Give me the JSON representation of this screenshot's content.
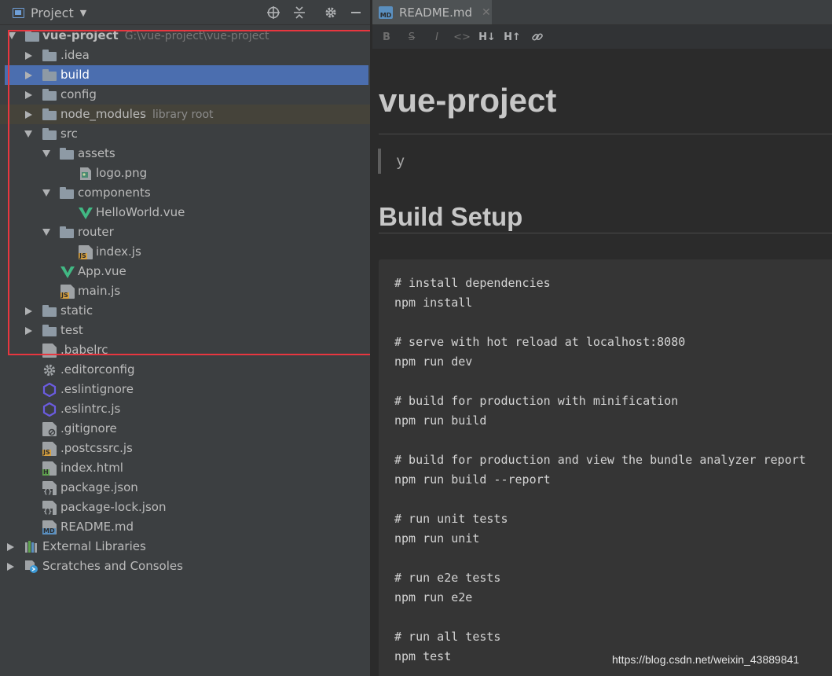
{
  "left_panel": {
    "title": "Project",
    "toolbar_icons": [
      "locate-icon",
      "collapse-all-icon",
      "gear-icon",
      "minimize-icon"
    ]
  },
  "tree": {
    "items": [
      {
        "label": "vue-project",
        "path": "G:\\vue-project\\vue-project",
        "icon": "module-folder-icon"
      },
      {
        "label": ".idea",
        "icon": "folder-icon"
      },
      {
        "label": "build",
        "icon": "folder-icon"
      },
      {
        "label": "config",
        "icon": "folder-icon"
      },
      {
        "label": "node_modules",
        "path": "library root",
        "icon": "folder-icon"
      },
      {
        "label": "src",
        "icon": "folder-icon"
      },
      {
        "label": "assets",
        "icon": "folder-icon"
      },
      {
        "label": "logo.png",
        "icon": "image-file-icon"
      },
      {
        "label": "components",
        "icon": "folder-icon"
      },
      {
        "label": "HelloWorld.vue",
        "icon": "vue-icon"
      },
      {
        "label": "router",
        "icon": "folder-icon"
      },
      {
        "label": "index.js",
        "icon": "js-file-icon"
      },
      {
        "label": "App.vue",
        "icon": "vue-icon"
      },
      {
        "label": "main.js",
        "icon": "js-file-icon"
      },
      {
        "label": "static",
        "icon": "folder-icon"
      },
      {
        "label": "test",
        "icon": "folder-icon"
      },
      {
        "label": ".babelrc",
        "icon": "config-file-icon"
      },
      {
        "label": ".editorconfig",
        "icon": "gear-icon"
      },
      {
        "label": ".eslintignore",
        "icon": "eslint-icon"
      },
      {
        "label": ".eslintrc.js",
        "icon": "eslint-icon"
      },
      {
        "label": ".gitignore",
        "icon": "ignore-file-icon"
      },
      {
        "label": ".postcssrc.js",
        "icon": "js-file-icon"
      },
      {
        "label": "index.html",
        "icon": "html-file-icon"
      },
      {
        "label": "package.json",
        "icon": "json-file-icon"
      },
      {
        "label": "package-lock.json",
        "icon": "json-file-icon"
      },
      {
        "label": "README.md",
        "icon": "markdown-file-icon"
      },
      {
        "label": "External Libraries",
        "icon": "libraries-icon"
      },
      {
        "label": "Scratches and Consoles",
        "icon": "scratches-icon"
      }
    ]
  },
  "editor": {
    "tab_label": "README.md",
    "toolbar": [
      "B",
      "S",
      "I",
      "<>",
      "H↓",
      "H↑",
      "link"
    ],
    "h1": "vue-project",
    "quote": "y",
    "h2": "Build Setup",
    "code_lines": [
      "# install dependencies",
      "npm install",
      "",
      "# serve with hot reload at localhost:8080",
      "npm run dev",
      "",
      "# build for production with minification",
      "npm run build",
      "",
      "# build for production and view the bundle analyzer report",
      "npm run build --report",
      "",
      "# run unit tests",
      "npm run unit",
      "",
      "# run e2e tests",
      "npm run e2e",
      "",
      "# run all tests",
      "npm test"
    ]
  },
  "watermark": "https://blog.csdn.net/weixin_43889841",
  "colors": {
    "selection": "#4b6eaf",
    "highlight_box": "#e8363f",
    "vue_green": "#41b883"
  }
}
